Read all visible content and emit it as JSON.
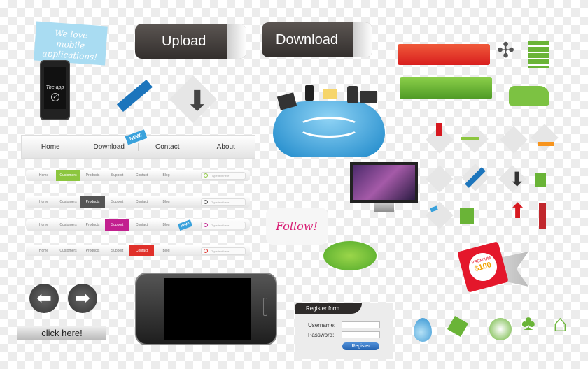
{
  "bubble": {
    "text": "We love mobile applications!"
  },
  "small_phone": {
    "screen_text": "The app"
  },
  "buttons": {
    "upload": "Upload",
    "download": "Download",
    "click_here": "click here!"
  },
  "main_nav": {
    "items": [
      "Home",
      "Download",
      "Contact",
      "About"
    ],
    "badge": "NEW!"
  },
  "small_navs": [
    {
      "items": [
        "Home",
        "Customers",
        "Products",
        "Support",
        "Contact",
        "Blog"
      ],
      "active": 1,
      "color": "#8cc63f",
      "search_placeholder": "Type text here"
    },
    {
      "items": [
        "Home",
        "Customers",
        "Products",
        "Support",
        "Contact",
        "Blog"
      ],
      "active": 2,
      "color": "#555555",
      "search_placeholder": "Type text here"
    },
    {
      "items": [
        "Home",
        "Customers",
        "Products",
        "Support",
        "Contact",
        "Blog"
      ],
      "active": 3,
      "color": "#c2208f",
      "search_placeholder": "Type text here",
      "badge": "NEW!"
    },
    {
      "items": [
        "Home",
        "Customers",
        "Products",
        "Support",
        "Contact",
        "Blog"
      ],
      "active": 4,
      "color": "#e0302a",
      "search_placeholder": "Type text here"
    }
  ],
  "follow": {
    "text": "Follow!"
  },
  "premium_tag": {
    "label": "PREMIUM",
    "price": "$100"
  },
  "register_form": {
    "title": "Register form",
    "username_label": "Username:",
    "password_label": "Password:",
    "username_value": "",
    "password_value": "",
    "submit": "Register"
  },
  "colors": {
    "red_banner": "#e0362a",
    "green_banner": "#6ab437",
    "cloud": "#3aa2dc"
  }
}
